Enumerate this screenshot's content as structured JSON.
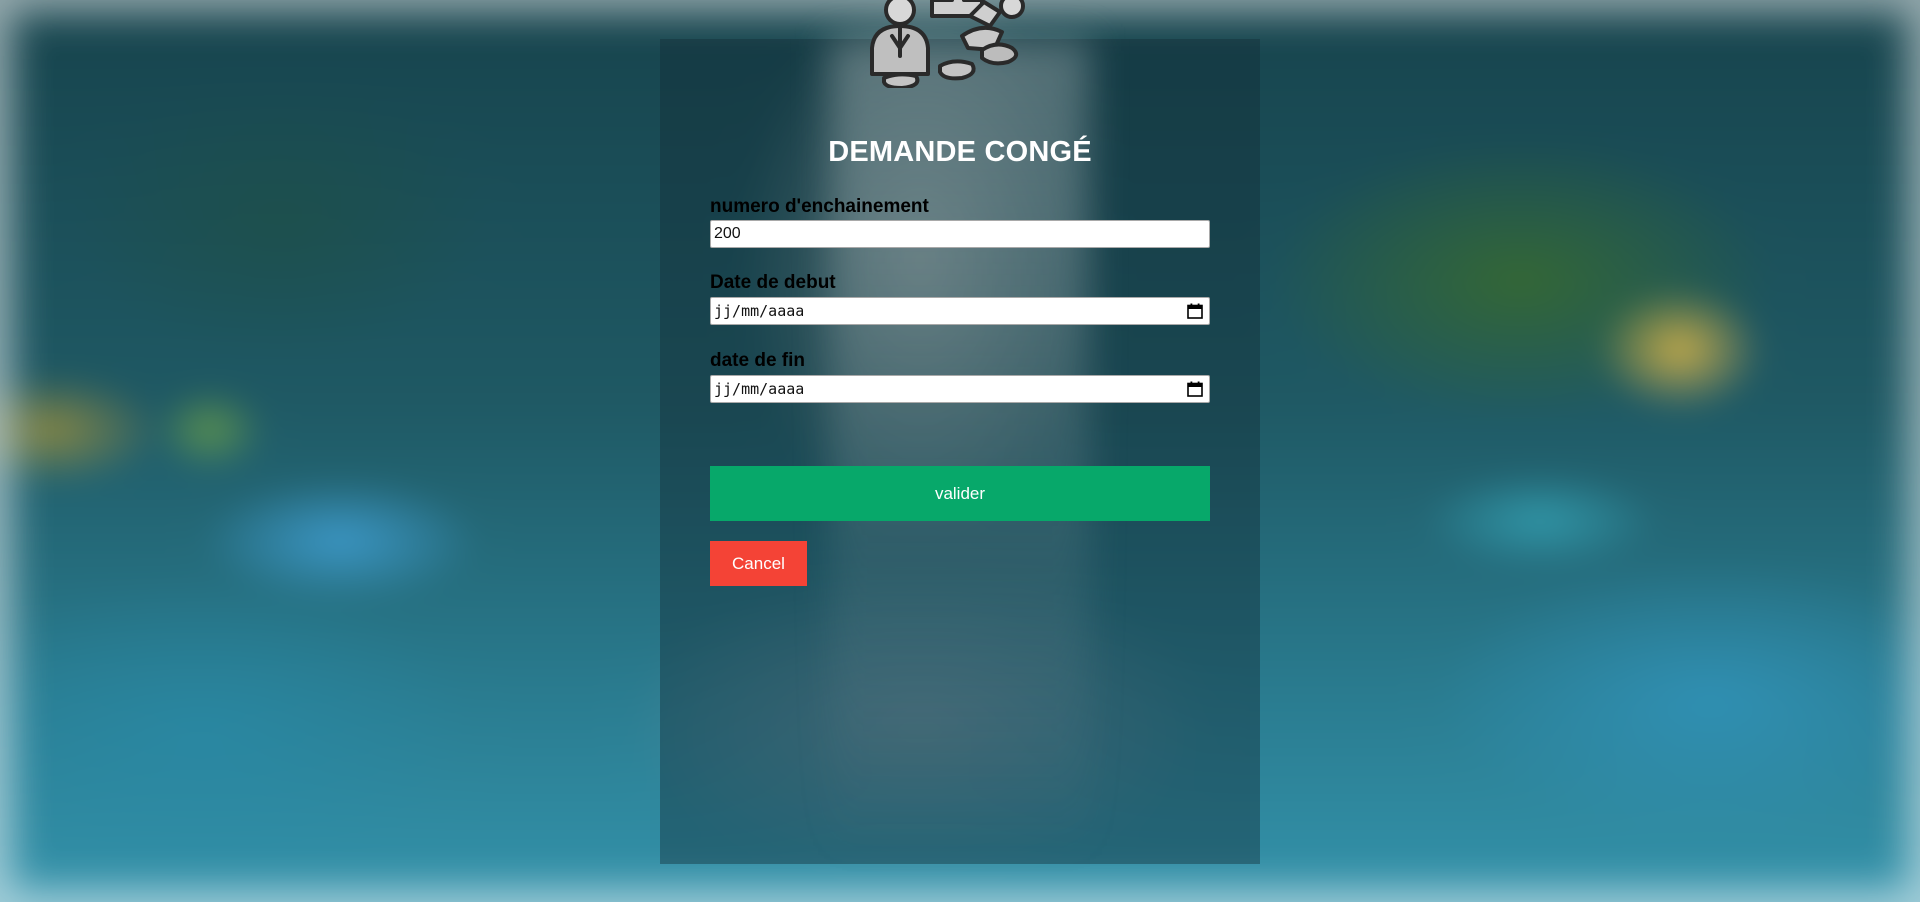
{
  "form": {
    "title": "DEMANDE CONGÉ",
    "fields": [
      {
        "label": "numero d'enchainement",
        "value": "200"
      },
      {
        "label": "Date de debut",
        "placeholder": "jj/mm/aaaa"
      },
      {
        "label": "date de fin",
        "placeholder": "jj/mm/aaaa"
      }
    ],
    "submit_label": "valider",
    "cancel_label": "Cancel"
  },
  "colors": {
    "submit": "#07a86a",
    "cancel": "#f44336",
    "title": "#ffffff"
  },
  "icons": {
    "logo": "people-puzzle-logo",
    "date_picker": "calendar-icon"
  }
}
